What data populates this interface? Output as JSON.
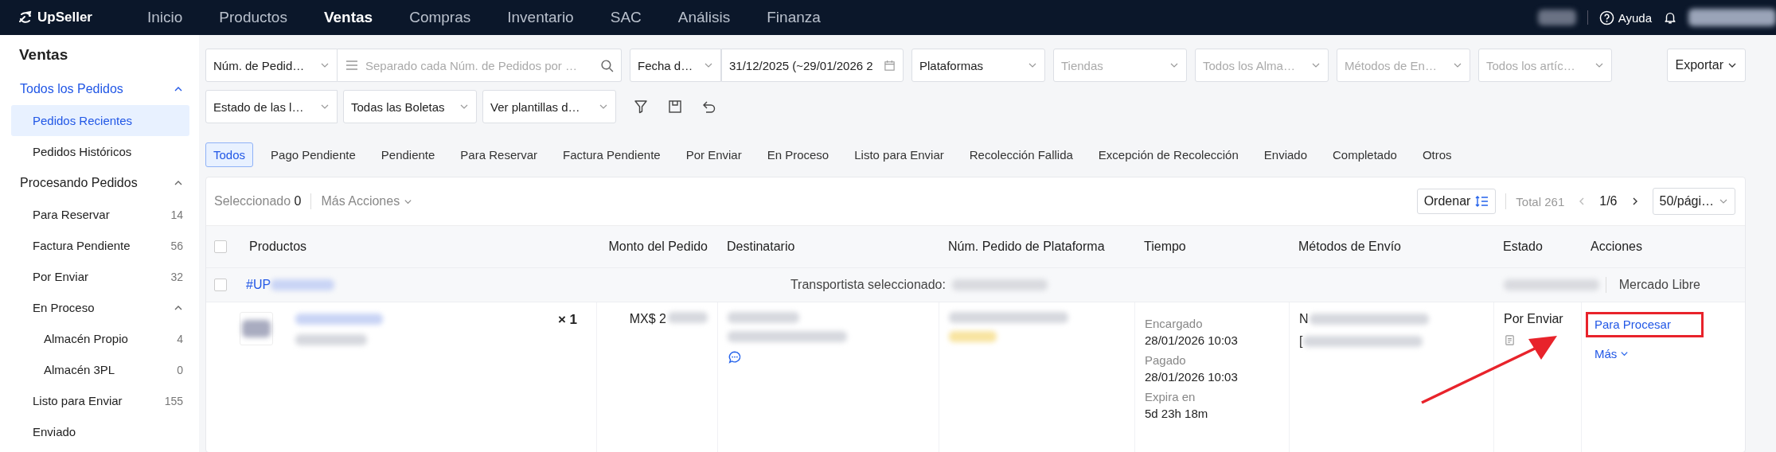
{
  "top_nav": {
    "logo": "UpSeller",
    "items": [
      {
        "label": "Inicio",
        "selected": false
      },
      {
        "label": "Productos",
        "selected": false
      },
      {
        "label": "Ventas",
        "selected": true
      },
      {
        "label": "Compras",
        "selected": false
      },
      {
        "label": "Inventario",
        "selected": false
      },
      {
        "label": "SAC",
        "selected": false
      },
      {
        "label": "Análisis",
        "selected": false
      },
      {
        "label": "Finanza",
        "selected": false
      }
    ],
    "help": "Ayuda"
  },
  "sidebar": {
    "title": "Ventas",
    "groups": [
      {
        "label": "Todos los Pedidos",
        "expanded": true,
        "children": [
          {
            "label": "Pedidos Recientes",
            "selected": true
          },
          {
            "label": "Pedidos Históricos",
            "selected": false
          }
        ]
      },
      {
        "label": "Procesando Pedidos",
        "expanded": true,
        "children": [
          {
            "label": "Para Reservar",
            "count": "14",
            "selected": false
          },
          {
            "label": "Factura Pendiente",
            "count": "56",
            "selected": false
          },
          {
            "label": "Por Enviar",
            "count": "32",
            "selected": false
          },
          {
            "label": "En Proceso",
            "expanded": true,
            "selected": false,
            "children": [
              {
                "label": "Almacén Propio",
                "count": "4",
                "selected": false
              },
              {
                "label": "Almacén 3PL",
                "count": "0",
                "selected": false
              }
            ]
          },
          {
            "label": "Listo para Enviar",
            "count": "155",
            "selected": false
          },
          {
            "label": "Enviado",
            "selected": false
          }
        ]
      }
    ]
  },
  "filters": [
    {
      "kind": "select",
      "value": "Núm. de Pedid…"
    },
    {
      "kind": "search",
      "placeholder": "Separado cada Núm. de Pedidos por …"
    },
    {
      "kind": "select",
      "value": "Fecha d…"
    },
    {
      "kind": "date",
      "value": "31/12/2025 (~29/01/2026 2"
    },
    {
      "kind": "select",
      "value": "Plataformas"
    },
    {
      "kind": "select",
      "placeholder": "Tiendas"
    },
    {
      "kind": "select",
      "placeholder": "Todos los Alma…"
    },
    {
      "kind": "select",
      "placeholder": "Métodos de En…"
    },
    {
      "kind": "select",
      "placeholder": "Todos los artíc…"
    }
  ],
  "export_button": "Exportar",
  "filters_row2": [
    {
      "value": "Estado de las l…"
    },
    {
      "value": "Todas las Boletas"
    },
    {
      "value": "Ver plantillas d…"
    }
  ],
  "status_tabs": [
    {
      "label": "Todos",
      "selected": true
    },
    {
      "label": "Pago Pendiente",
      "selected": false
    },
    {
      "label": "Pendiente",
      "selected": false
    },
    {
      "label": "Para Reservar",
      "selected": false
    },
    {
      "label": "Factura Pendiente",
      "selected": false
    },
    {
      "label": "Por Enviar",
      "selected": false
    },
    {
      "label": "En Proceso",
      "selected": false
    },
    {
      "label": "Listo para Enviar",
      "selected": false
    },
    {
      "label": "Recolección Fallida",
      "selected": false
    },
    {
      "label": "Excepción de Recolección",
      "selected": false
    },
    {
      "label": "Enviado",
      "selected": false
    },
    {
      "label": "Completado",
      "selected": false
    },
    {
      "label": "Otros",
      "selected": false
    }
  ],
  "table": {
    "toolbar": {
      "selected_label": "Seleccionado",
      "selected_count": "0",
      "more_actions": "Más Acciones",
      "sort": "Ordenar",
      "total": "Total 261",
      "page": "1/6",
      "page_size": "50/pági…"
    },
    "all_checked": false,
    "columns": [
      "Productos",
      "Monto del Pedido",
      "Destinatario",
      "Núm. Pedido de Plataforma",
      "Tiempo",
      "Métodos de Envío",
      "Estado",
      "Acciones"
    ],
    "order": {
      "number_prefix": "#UP",
      "carrier_label": "Transportista seleccionado:",
      "platform": "Mercado Libre",
      "checked": false,
      "quantity": "× 1",
      "amount_prefix": "MX$ 2",
      "times": [
        {
          "label": "Encargado",
          "value": "28/01/2026 10:03"
        },
        {
          "label": "Pagado",
          "value": "28/01/2026 10:03"
        },
        {
          "label": "Expira en",
          "value": "5d 23h 18m"
        }
      ],
      "shipping_prefixes": [
        "N",
        "["
      ],
      "status": "Por Enviar",
      "actions": [
        "Para Procesar",
        "Más"
      ]
    }
  }
}
